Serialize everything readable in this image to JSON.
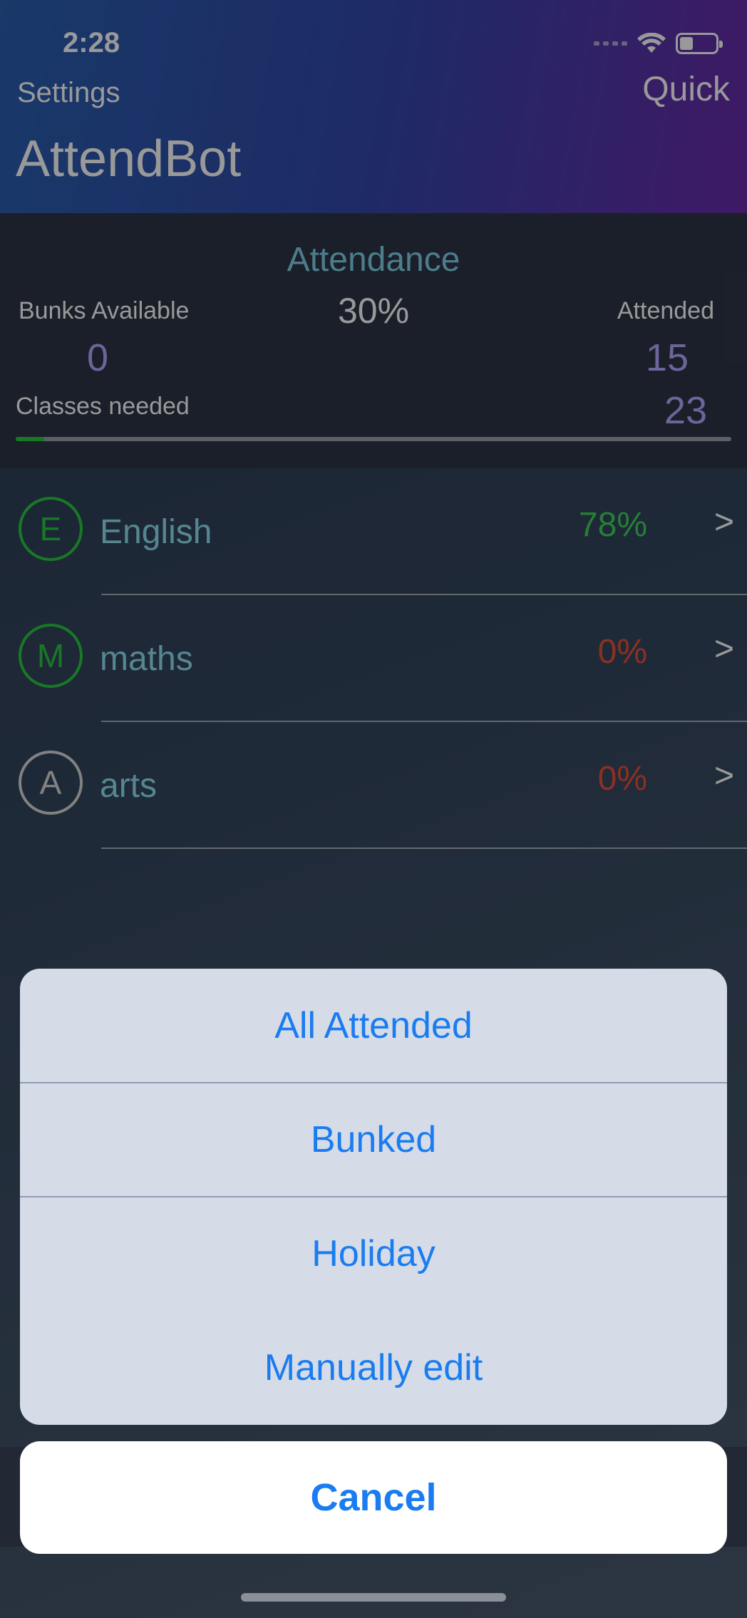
{
  "status_bar": {
    "time": "2:28"
  },
  "nav": {
    "left": "Settings",
    "right": "Quick",
    "title": "AttendBot"
  },
  "summary": {
    "attendance_label": "Attendance",
    "attendance_percent": "30%",
    "attendance_fraction": 0.3,
    "bunks_label": "Bunks Available",
    "bunks_value": "0",
    "attended_label": "Attended",
    "attended_value": "15",
    "classes_needed_label": "Classes needed",
    "classes_needed_value": "23",
    "progress_fraction": 0.04
  },
  "subjects": [
    {
      "initial": "E",
      "name": "English",
      "percent": "78%",
      "status": "good",
      "chevron": ">"
    },
    {
      "initial": "M",
      "name": "maths",
      "percent": "0%",
      "status": "bad",
      "chevron": ">"
    },
    {
      "initial": "A",
      "name": "arts",
      "percent": "0%",
      "status": "bad",
      "chevron": ">"
    }
  ],
  "action_sheet": {
    "options": [
      "All Attended",
      "Bunked",
      "Holiday",
      "Manually edit"
    ],
    "cancel": "Cancel"
  },
  "colors": {
    "accent": "#1a7cf0",
    "good": "#3fd35a",
    "bad": "#e8503a",
    "subject_name": "#8fe0f0",
    "value_purple": "#b6a8ff"
  },
  "icons": {
    "wifi": "wifi-icon",
    "battery": "battery-icon",
    "signal": "signal-icon",
    "chevron": "chevron-right-icon"
  }
}
